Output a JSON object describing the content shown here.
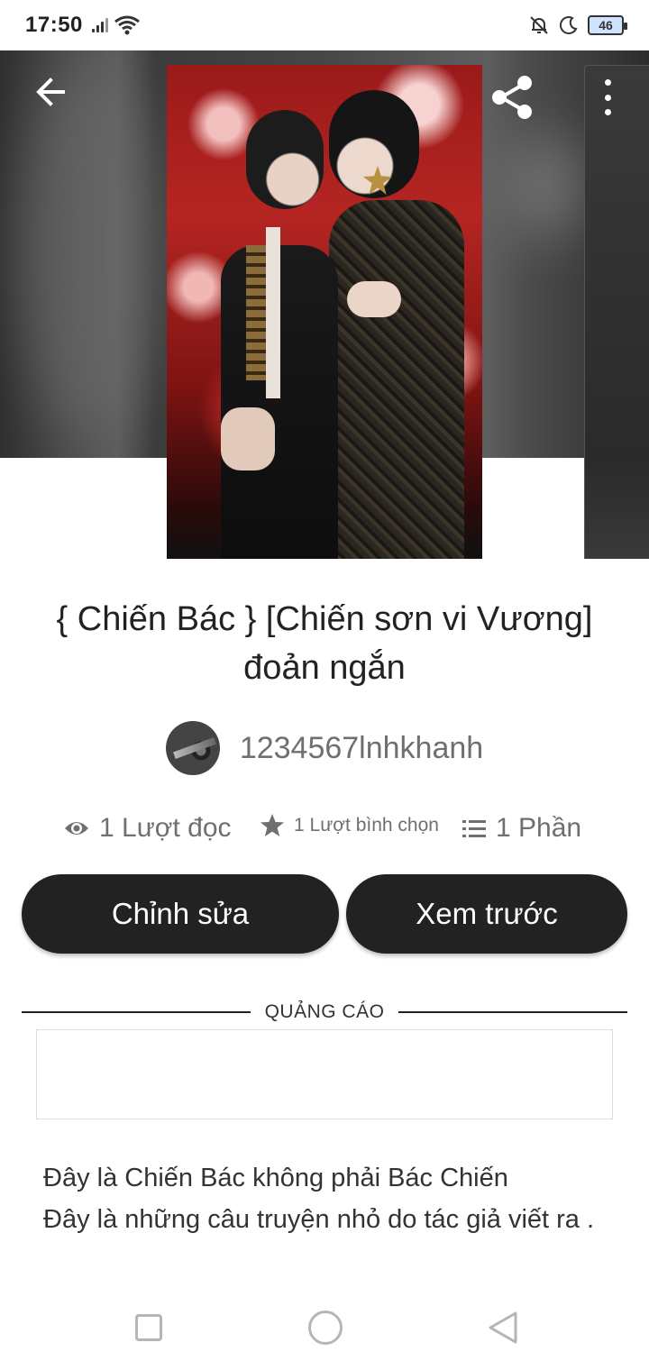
{
  "status_bar": {
    "time": "17:50",
    "battery": "46",
    "icons": [
      "signal-icon",
      "wifi-icon",
      "mute-bell-icon",
      "moon-icon",
      "battery-icon"
    ]
  },
  "header": {
    "back_icon": "arrow-left-icon",
    "share_icon": "share-icon",
    "more_icon": "more-vertical-icon"
  },
  "story": {
    "title": "{ Chiến Bác } [Chiến sơn vi Vương] đoản ngắn",
    "author": "1234567lnhkhanh",
    "stats": {
      "reads": "1 Lượt đọc",
      "votes": "1 Lượt bình chọn",
      "parts": "1 Phần"
    },
    "description": [
      "Đây là Chiến Bác không phải Bác Chiến",
      "Đây là những câu truyện nhỏ do tác giả viết ra ."
    ]
  },
  "actions": {
    "edit_label": "Chỉnh sửa",
    "preview_label": "Xem trước"
  },
  "ad": {
    "label": "QUẢNG CÁO"
  },
  "colors": {
    "button_bg": "#222222",
    "muted_text": "#6f6f6f"
  }
}
